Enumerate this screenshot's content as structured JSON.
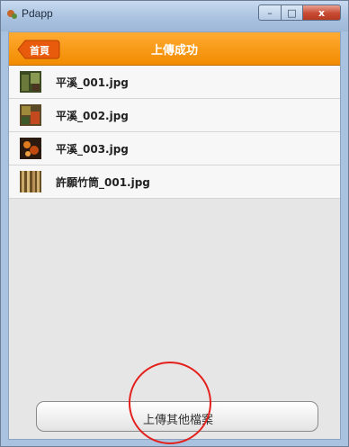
{
  "window": {
    "title": "Pdapp",
    "controls": {
      "minimize": "–",
      "maximize": "□",
      "close": "x"
    }
  },
  "navbar": {
    "back_label": "首頁",
    "title": "上傳成功"
  },
  "files": [
    {
      "name": "平溪_001.jpg",
      "thumb": "photo-thumbnail"
    },
    {
      "name": "平溪_002.jpg",
      "thumb": "photo-thumbnail"
    },
    {
      "name": "平溪_003.jpg",
      "thumb": "photo-thumbnail"
    },
    {
      "name": "許願竹筒_001.jpg",
      "thumb": "photo-thumbnail"
    }
  ],
  "upload_button": {
    "label": "上傳其他檔案"
  },
  "colors": {
    "navbar": "#f28b00",
    "back_button": "#e85b0c",
    "highlight_circle": "#e3201b"
  }
}
